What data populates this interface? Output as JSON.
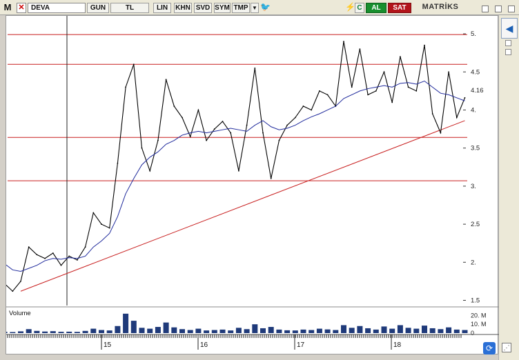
{
  "toolbar": {
    "logo": "M",
    "symbol": "DEVA",
    "period": "GUN",
    "currency": "TL",
    "buttons": [
      "LIN",
      "KHN",
      "SVD",
      "SYM",
      "TMP"
    ],
    "c_label": "C",
    "buy_label": "AL",
    "sell_label": "SAT",
    "brand": "MATRİKS"
  },
  "icons": {
    "close": "x-icon",
    "dropdown": "chevron-down-icon",
    "twitter": "bird-icon",
    "alarm": "lightning-icon",
    "back": "arrow-left-icon",
    "refresh": "refresh-icon",
    "resize": "resize-grip-icon"
  },
  "colors": {
    "price": "#000000",
    "moving_average": "#1f2a9c",
    "horizontal_levels": "#c81e1e",
    "trendline": "#c81e1e",
    "volume": "#1f3a7a",
    "buy": "#188f2e",
    "sell": "#b3141a"
  },
  "chart_data": [
    {
      "type": "line",
      "panel": "price",
      "x_tick_labels": [
        "15",
        "16",
        "17",
        "18"
      ],
      "y_ticks": [
        1.5,
        2,
        2.5,
        3,
        3.5,
        4,
        4.5,
        5
      ],
      "y_tick_labels": [
        "1.5",
        "2.",
        "2.5",
        "3.",
        "3.5",
        "4.",
        "4.5",
        "5."
      ],
      "last_value_label": "4.16",
      "ylim": [
        1.45,
        5.2
      ],
      "grid": false,
      "horizontal_levels": [
        4.99,
        4.6,
        3.64,
        3.07
      ],
      "trendline": {
        "start": {
          "x": "2014-03",
          "y": 1.62
        },
        "end": {
          "x": "2018-10",
          "y": 3.86
        }
      },
      "series": [
        {
          "x": [
            "2014-01",
            "2014-02",
            "2014-03",
            "2014-04",
            "2014-05",
            "2014-06",
            "2014-07",
            "2014-08",
            "2014-09",
            "2014-10",
            "2014-11",
            "2014-12",
            "2015-01",
            "2015-02",
            "2015-03",
            "2015-04",
            "2015-05",
            "2015-06",
            "2015-07",
            "2015-08",
            "2015-09",
            "2015-10",
            "2015-11",
            "2015-12",
            "2016-01",
            "2016-02",
            "2016-03",
            "2016-04",
            "2016-05",
            "2016-06",
            "2016-07",
            "2016-08",
            "2016-09",
            "2016-10",
            "2016-11",
            "2016-12",
            "2017-01",
            "2017-02",
            "2017-03",
            "2017-04",
            "2017-05",
            "2017-06",
            "2017-07",
            "2017-08",
            "2017-09",
            "2017-10",
            "2017-11",
            "2017-12",
            "2018-01",
            "2018-02",
            "2018-03",
            "2018-04",
            "2018-05",
            "2018-06",
            "2018-07",
            "2018-08",
            "2018-09",
            "2018-10"
          ],
          "values": [
            1.72,
            1.62,
            1.75,
            2.2,
            2.1,
            2.05,
            2.12,
            1.96,
            2.08,
            2.03,
            2.2,
            2.65,
            2.5,
            2.45,
            3.3,
            4.3,
            4.6,
            3.5,
            3.2,
            3.6,
            4.4,
            4.05,
            3.9,
            3.65,
            4.0,
            3.6,
            3.75,
            3.85,
            3.7,
            3.2,
            3.8,
            4.55,
            3.7,
            3.1,
            3.6,
            3.8,
            3.9,
            4.05,
            4.0,
            4.25,
            4.2,
            4.05,
            4.9,
            4.3,
            4.8,
            4.2,
            4.25,
            4.5,
            4.1,
            4.7,
            4.3,
            4.25,
            4.85,
            3.95,
            3.7,
            4.5,
            3.9,
            4.16
          ]
        },
        {
          "values": [
            1.98,
            1.9,
            1.88,
            1.92,
            1.96,
            2.02,
            2.05,
            2.04,
            2.06,
            2.05,
            2.08,
            2.2,
            2.28,
            2.38,
            2.6,
            2.9,
            3.1,
            3.28,
            3.38,
            3.45,
            3.55,
            3.6,
            3.67,
            3.7,
            3.72,
            3.7,
            3.72,
            3.74,
            3.76,
            3.74,
            3.72,
            3.8,
            3.86,
            3.78,
            3.74,
            3.76,
            3.8,
            3.86,
            3.91,
            3.95,
            4.0,
            4.05,
            4.15,
            4.2,
            4.25,
            4.28,
            4.3,
            4.32,
            4.3,
            4.35,
            4.36,
            4.34,
            4.38,
            4.3,
            4.22,
            4.2,
            4.16,
            4.12
          ]
        }
      ]
    },
    {
      "type": "bar",
      "panel": "volume",
      "title": "Volume",
      "y_tick_labels": [
        "20. M",
        "10. M",
        "0"
      ],
      "ylim": [
        0,
        25
      ],
      "values": [
        1.5,
        1.2,
        2.0,
        4.5,
        2.5,
        1.8,
        2.2,
        1.5,
        1.6,
        1.4,
        2.5,
        5.0,
        3.5,
        3.0,
        8.0,
        22.0,
        14.0,
        6.0,
        5.0,
        7.0,
        12.0,
        6.5,
        4.5,
        3.5,
        5.0,
        3.0,
        3.5,
        4.0,
        3.0,
        6.0,
        4.5,
        10.0,
        5.5,
        7.0,
        4.0,
        3.2,
        3.0,
        4.0,
        3.5,
        5.0,
        4.2,
        3.5,
        9.0,
        6.0,
        8.0,
        5.5,
        4.0,
        7.5,
        5.0,
        9.0,
        6.0,
        5.0,
        8.5,
        5.5,
        4.5,
        6.5,
        4.0,
        3.5
      ]
    }
  ]
}
